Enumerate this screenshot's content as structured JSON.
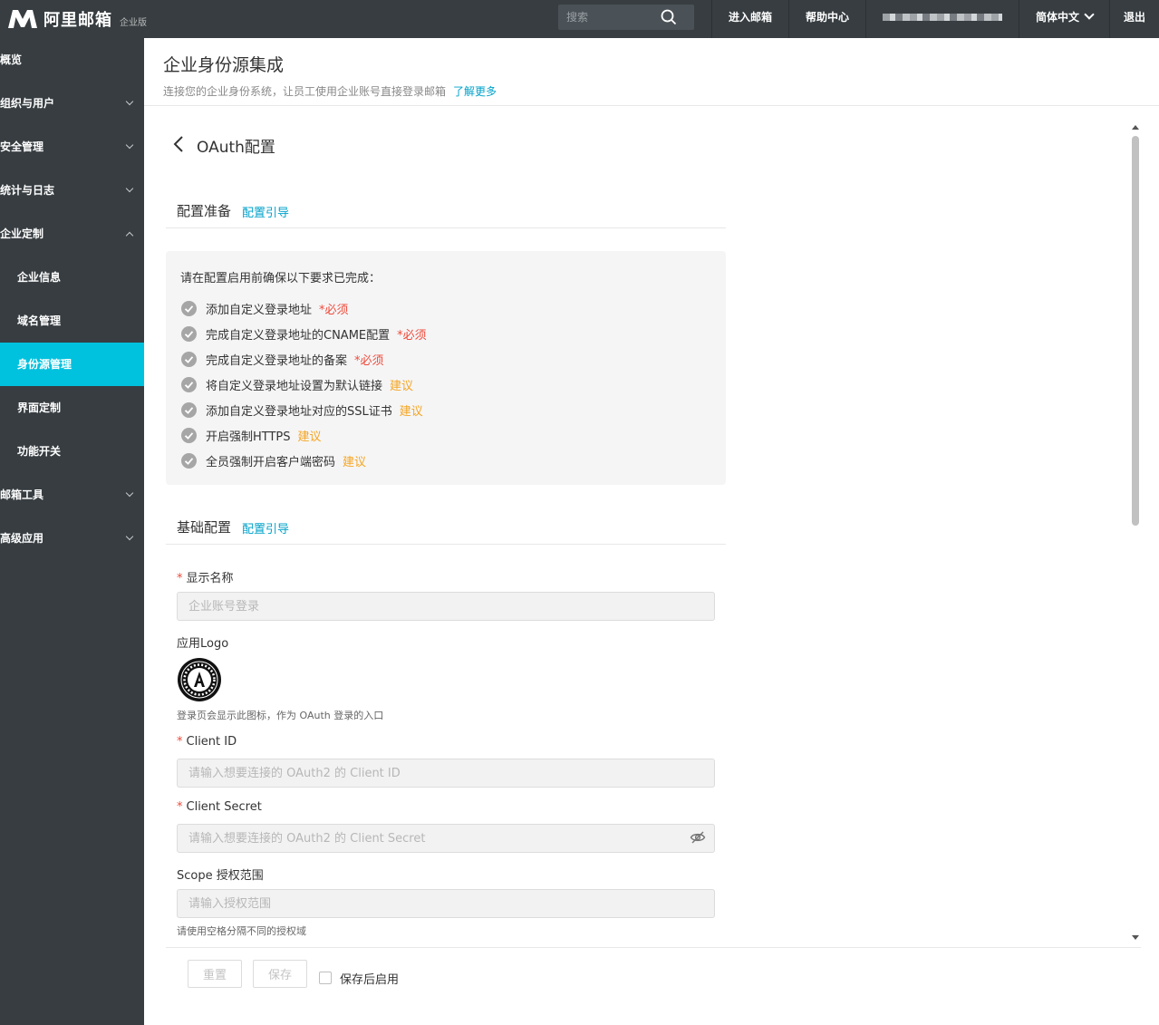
{
  "topbar": {
    "logo_text": "阿里邮箱",
    "logo_sub": "企业版",
    "search_placeholder": "搜索",
    "nav": [
      "进入邮箱",
      "帮助中心"
    ],
    "language": "简体中文",
    "logout": "退出"
  },
  "sidebar": {
    "items": [
      {
        "label": "概览"
      },
      {
        "label": "组织与用户"
      },
      {
        "label": "安全管理"
      },
      {
        "label": "统计与日志"
      },
      {
        "label": "企业定制"
      },
      {
        "label": "企业信息"
      },
      {
        "label": "域名管理"
      },
      {
        "label": "身份源管理"
      },
      {
        "label": "界面定制"
      },
      {
        "label": "功能开关"
      },
      {
        "label": "邮箱工具"
      },
      {
        "label": "高级应用"
      }
    ]
  },
  "page": {
    "title": "企业身份源集成",
    "desc": "连接您的企业身份系统，让员工使用企业账号直接登录邮箱",
    "learn_more": "了解更多",
    "config_title": "OAuth配置"
  },
  "prep": {
    "title": "配置准备",
    "link": "配置引导",
    "intro": "请在配置启用前确保以下要求已完成：",
    "items": [
      {
        "text": "添加自定义登录地址",
        "tag": "*必须",
        "kind": "required"
      },
      {
        "text": "完成自定义登录地址的CNAME配置",
        "tag": "*必须",
        "kind": "required"
      },
      {
        "text": "完成自定义登录地址的备案",
        "tag": "*必须",
        "kind": "required"
      },
      {
        "text": "将自定义登录地址设置为默认链接",
        "tag": "建议",
        "kind": "suggest"
      },
      {
        "text": "添加自定义登录地址对应的SSL证书",
        "tag": "建议",
        "kind": "suggest"
      },
      {
        "text": "开启强制HTTPS",
        "tag": "建议",
        "kind": "suggest"
      },
      {
        "text": "全员强制开启客户端密码",
        "tag": "建议",
        "kind": "suggest"
      }
    ]
  },
  "basic": {
    "title": "基础配置",
    "link": "配置引导",
    "display_name_label": "显示名称",
    "display_name_placeholder": "企业账号登录",
    "logo_label": "应用Logo",
    "logo_hint": "登录页会显示此图标，作为 OAuth 登录的入口",
    "client_id_label": "Client ID",
    "client_id_placeholder": "请输入想要连接的 OAuth2 的 Client ID",
    "client_secret_label": "Client Secret",
    "client_secret_placeholder": "请输入想要连接的 OAuth2 的 Client Secret",
    "scope_label": "Scope 授权范围",
    "scope_placeholder": "请输入授权范围",
    "scope_hint": "请使用空格分隔不同的授权域"
  },
  "footer": {
    "reset": "重置",
    "save": "保存",
    "enable_after_save": "保存后启用"
  }
}
